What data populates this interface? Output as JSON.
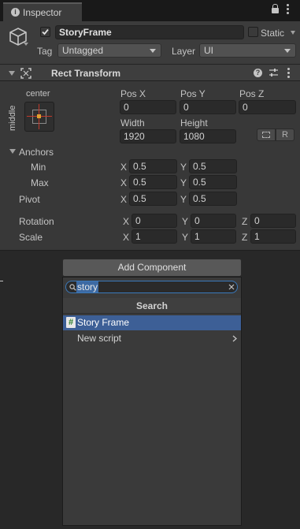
{
  "tab": {
    "title": "Inspector"
  },
  "object": {
    "active_checked": true,
    "name": "StoryFrame",
    "static_label": "Static",
    "tag_label": "Tag",
    "tag_value": "Untagged",
    "layer_label": "Layer",
    "layer_value": "UI"
  },
  "rect_transform": {
    "title": "Rect Transform",
    "anchor_h": "center",
    "anchor_v": "middle",
    "pos_x_label": "Pos X",
    "pos_x": "0",
    "pos_y_label": "Pos Y",
    "pos_y": "0",
    "pos_z_label": "Pos Z",
    "pos_z": "0",
    "width_label": "Width",
    "width": "1920",
    "height_label": "Height",
    "height": "1080",
    "raw_button": "R",
    "anchors_label": "Anchors",
    "min_label": "Min",
    "min_x": "0.5",
    "min_y": "0.5",
    "max_label": "Max",
    "max_x": "0.5",
    "max_y": "0.5",
    "pivot_label": "Pivot",
    "pivot_x": "0.5",
    "pivot_y": "0.5",
    "rotation_label": "Rotation",
    "rot_x": "0",
    "rot_y": "0",
    "rot_z": "0",
    "scale_label": "Scale",
    "scale_x": "1",
    "scale_y": "1",
    "scale_z": "1",
    "x": "X",
    "y": "Y",
    "z": "Z"
  },
  "add_component": {
    "button_label": "Add Component",
    "search_value": "story",
    "section_title": "Search",
    "items": [
      {
        "label": "Story Frame"
      },
      {
        "label": "New script"
      }
    ]
  }
}
